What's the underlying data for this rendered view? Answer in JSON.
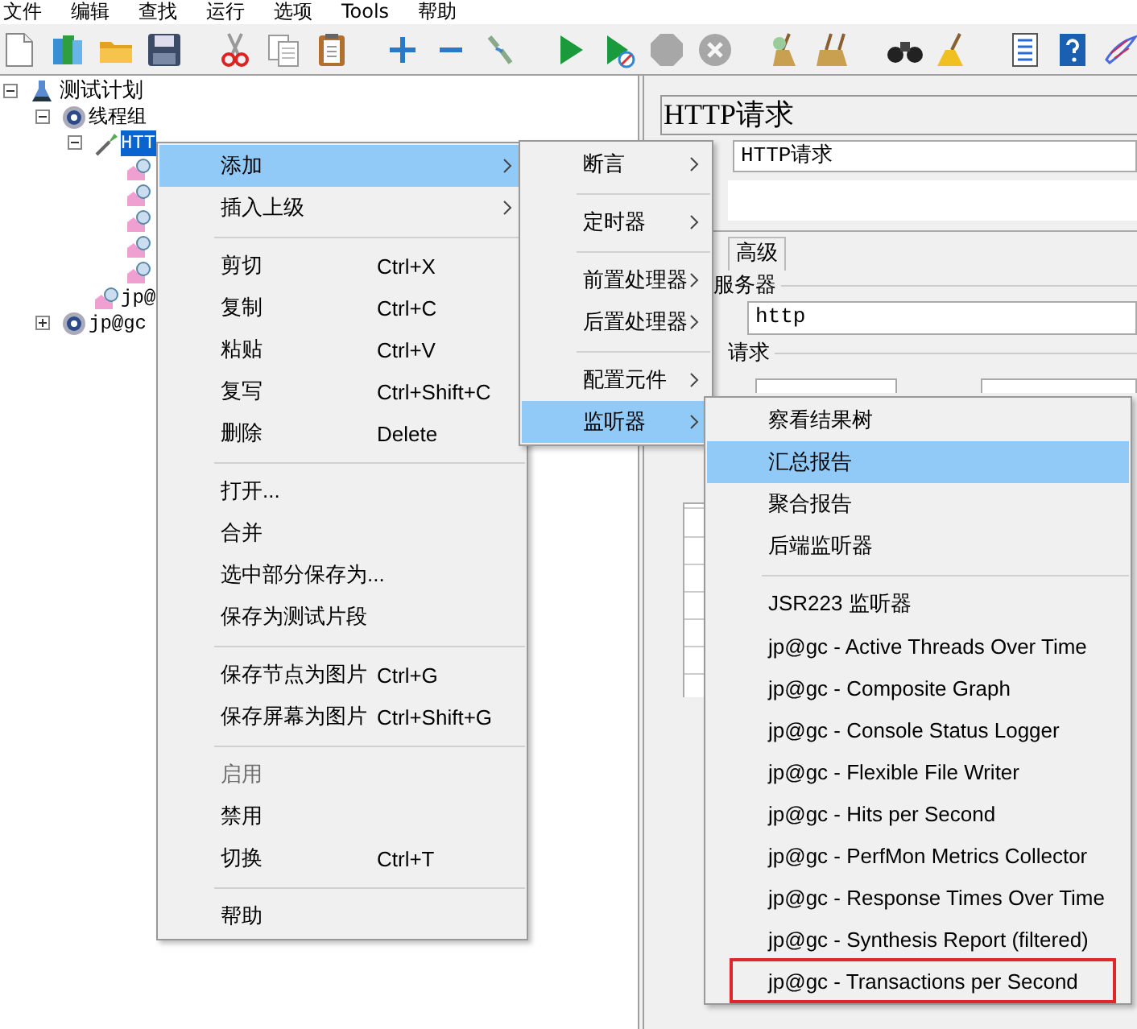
{
  "menu_bar": [
    "文件",
    "编辑",
    "查找",
    "运行",
    "选项",
    "Tools",
    "帮助"
  ],
  "toolbar": [
    {
      "kind": "new",
      "disabled": false
    },
    {
      "kind": "templates",
      "disabled": false
    },
    {
      "kind": "open",
      "disabled": false
    },
    {
      "kind": "save",
      "disabled": false
    },
    {
      "kind": "separator"
    },
    {
      "kind": "cut",
      "disabled": false
    },
    {
      "kind": "copy",
      "disabled": false
    },
    {
      "kind": "paste",
      "disabled": false
    },
    {
      "kind": "separator"
    },
    {
      "kind": "expand",
      "disabled": false
    },
    {
      "kind": "collapse",
      "disabled": false
    },
    {
      "kind": "toggle",
      "disabled": false
    },
    {
      "kind": "separator"
    },
    {
      "kind": "start",
      "disabled": false
    },
    {
      "kind": "start_no_pause",
      "disabled": false
    },
    {
      "kind": "stop",
      "disabled": true
    },
    {
      "kind": "shutdown",
      "disabled": true
    },
    {
      "kind": "separator"
    },
    {
      "kind": "clear",
      "disabled": false
    },
    {
      "kind": "clear_all",
      "disabled": false
    },
    {
      "kind": "separator"
    },
    {
      "kind": "search",
      "disabled": false
    },
    {
      "kind": "reset_search",
      "disabled": false
    },
    {
      "kind": "separator"
    },
    {
      "kind": "function_helper",
      "disabled": false
    },
    {
      "kind": "help",
      "disabled": false
    },
    {
      "kind": "logo",
      "disabled": false
    }
  ],
  "tree": [
    {
      "label": "测试计划",
      "kind": "plan",
      "expanded": true,
      "selected": false,
      "children": [
        {
          "label": "线程组",
          "kind": "thread_group",
          "expanded": true,
          "selected": false,
          "children": [
            {
              "label": "HTT",
              "kind": "sampler",
              "expanded": true,
              "selected": true,
              "children": [
                {
                  "kind": "listener",
                  "selected": false
                },
                {
                  "kind": "listener",
                  "selected": false
                },
                {
                  "kind": "listener",
                  "selected": false
                },
                {
                  "kind": "listener",
                  "selected": false
                },
                {
                  "kind": "listener",
                  "selected": false
                }
              ]
            },
            {
              "label": "jp@",
              "kind": "listener",
              "selected": false
            }
          ]
        },
        {
          "label": "jp@gc",
          "kind": "thread_group",
          "expanded": false,
          "selected": false
        }
      ]
    }
  ],
  "editor": {
    "title": "HTTP请求",
    "name_value": "HTTP请求",
    "tabs": [
      {
        "label": "高级",
        "selected": false
      }
    ],
    "server_group": "服务器",
    "protocol_value": "http",
    "request_group": "请求"
  },
  "context_menu": {
    "items": [
      {
        "kind": "item",
        "label": "添加",
        "submenu": true,
        "selected": true,
        "disabled": false
      },
      {
        "kind": "item",
        "label": "插入上级",
        "submenu": true,
        "selected": false,
        "disabled": false
      },
      {
        "kind": "separator"
      },
      {
        "kind": "item",
        "label": "剪切",
        "shortcut": "Ctrl+X",
        "selected": false,
        "disabled": false
      },
      {
        "kind": "item",
        "label": "复制",
        "shortcut": "Ctrl+C",
        "selected": false,
        "disabled": false
      },
      {
        "kind": "item",
        "label": "粘贴",
        "shortcut": "Ctrl+V",
        "selected": false,
        "disabled": false
      },
      {
        "kind": "item",
        "label": "复写",
        "shortcut": "Ctrl+Shift+C",
        "selected": false,
        "disabled": false
      },
      {
        "kind": "item",
        "label": "删除",
        "shortcut": "Delete",
        "selected": false,
        "disabled": false
      },
      {
        "kind": "separator"
      },
      {
        "kind": "item",
        "label": "打开...",
        "selected": false,
        "disabled": false
      },
      {
        "kind": "item",
        "label": "合并",
        "selected": false,
        "disabled": false
      },
      {
        "kind": "item",
        "label": "选中部分保存为...",
        "selected": false,
        "disabled": false
      },
      {
        "kind": "item",
        "label": "保存为测试片段",
        "selected": false,
        "disabled": false
      },
      {
        "kind": "separator"
      },
      {
        "kind": "item",
        "label": "保存节点为图片",
        "shortcut": "Ctrl+G",
        "selected": false,
        "disabled": false
      },
      {
        "kind": "item",
        "label": "保存屏幕为图片",
        "shortcut": "Ctrl+Shift+G",
        "selected": false,
        "disabled": false
      },
      {
        "kind": "separator"
      },
      {
        "kind": "item",
        "label": "启用",
        "selected": false,
        "disabled": true
      },
      {
        "kind": "item",
        "label": "禁用",
        "selected": false,
        "disabled": false
      },
      {
        "kind": "item",
        "label": "切换",
        "shortcut": "Ctrl+T",
        "selected": false,
        "disabled": false
      },
      {
        "kind": "separator"
      },
      {
        "kind": "item",
        "label": "帮助",
        "selected": false,
        "disabled": false
      }
    ]
  },
  "add_submenu": {
    "items": [
      {
        "kind": "item",
        "label": "断言",
        "submenu": true,
        "selected": false,
        "disabled": false
      },
      {
        "kind": "separator"
      },
      {
        "kind": "item",
        "label": "定时器",
        "submenu": true,
        "selected": false,
        "disabled": false
      },
      {
        "kind": "separator"
      },
      {
        "kind": "item",
        "label": "前置处理器",
        "submenu": true,
        "selected": false,
        "disabled": false
      },
      {
        "kind": "item",
        "label": "后置处理器",
        "submenu": true,
        "selected": false,
        "disabled": false
      },
      {
        "kind": "separator"
      },
      {
        "kind": "item",
        "label": "配置元件",
        "submenu": true,
        "selected": false,
        "disabled": false
      },
      {
        "kind": "item",
        "label": "监听器",
        "submenu": true,
        "selected": true,
        "disabled": false
      }
    ]
  },
  "listener_submenu": {
    "items": [
      {
        "kind": "item",
        "label": "察看结果树",
        "selected": false,
        "disabled": false,
        "marked": false
      },
      {
        "kind": "item",
        "label": "汇总报告",
        "selected": true,
        "disabled": false,
        "marked": false
      },
      {
        "kind": "item",
        "label": "聚合报告",
        "selected": false,
        "disabled": false,
        "marked": false
      },
      {
        "kind": "item",
        "label": "后端监听器",
        "selected": false,
        "disabled": false,
        "marked": false
      },
      {
        "kind": "separator"
      },
      {
        "kind": "item",
        "label": "JSR223 监听器",
        "selected": false,
        "disabled": false,
        "marked": false
      },
      {
        "kind": "item",
        "label": "jp@gc - Active Threads Over Time",
        "selected": false,
        "disabled": false,
        "marked": false
      },
      {
        "kind": "item",
        "label": "jp@gc - Composite Graph",
        "selected": false,
        "disabled": false,
        "marked": false
      },
      {
        "kind": "item",
        "label": "jp@gc - Console Status Logger",
        "selected": false,
        "disabled": false,
        "marked": false
      },
      {
        "kind": "item",
        "label": "jp@gc - Flexible File Writer",
        "selected": false,
        "disabled": false,
        "marked": false
      },
      {
        "kind": "item",
        "label": "jp@gc - Hits per Second",
        "selected": false,
        "disabled": false,
        "marked": false
      },
      {
        "kind": "item",
        "label": "jp@gc - PerfMon Metrics Collector",
        "selected": false,
        "disabled": false,
        "marked": false
      },
      {
        "kind": "item",
        "label": "jp@gc - Response Times Over Time",
        "selected": false,
        "disabled": false,
        "marked": false
      },
      {
        "kind": "item",
        "label": "jp@gc - Synthesis Report (filtered)",
        "selected": false,
        "disabled": false,
        "marked": false
      },
      {
        "kind": "item",
        "label": "jp@gc - Transactions per Second",
        "selected": false,
        "disabled": false,
        "marked": true
      }
    ]
  }
}
